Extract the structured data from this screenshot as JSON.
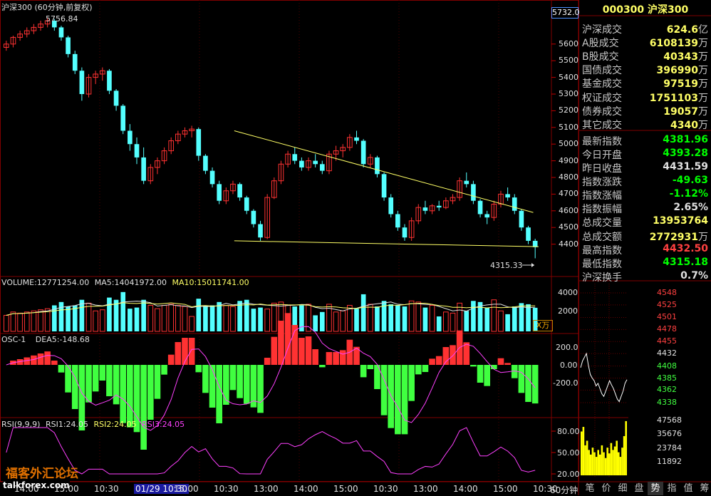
{
  "window": {
    "title": "沪深300 (60分钟,前复权)"
  },
  "main": {
    "title": "沪深300 (60分钟,前复权)",
    "high_label": "5756.84",
    "low_label": "4315.33",
    "top_badge": "5732.0",
    "y_ticks": [
      "5600",
      "5500",
      "5400",
      "5300",
      "5200",
      "5100",
      "5000",
      "4900",
      "4800",
      "4700",
      "4600",
      "4500",
      "4400"
    ]
  },
  "volume": {
    "label_main": "VOLUME:12771254.00",
    "label_ma5": "MA5:14041972.00",
    "label_ma10": "MA10:15011741.00",
    "y_ticks": [
      "4000",
      "2000"
    ],
    "unit": "X万"
  },
  "osc": {
    "label_main": "OSC-1",
    "label_dea": "DEA5:-148.68",
    "y_ticks": [
      "200.0",
      "0.00",
      "-200.0"
    ]
  },
  "rsi": {
    "label_main": "RSI(9,9,9)",
    "label_rsi1": "RSI1:24.05",
    "label_rsi2": "RSI2:24.05",
    "label_rsi3": "RSI3:24.05",
    "y_ticks": [
      "80.00",
      "50.00",
      "20.00"
    ]
  },
  "xaxis": {
    "labels": [
      "14:00",
      "15:00",
      "10:30",
      "01/29 10:30",
      "15:00",
      "10:30",
      "13:00",
      "14:00",
      "15:00",
      "10:30",
      "13:00",
      "14:00",
      "15:00",
      "10:30"
    ],
    "period": "60分钟"
  },
  "watermark": {
    "cn": "福客外汇论坛",
    "en": "talkforex.com"
  },
  "info": {
    "header": "000300 沪深300",
    "rows": [
      {
        "label": "沪深成交",
        "value": "624.6",
        "unit": "亿",
        "color": "#ffff66"
      },
      {
        "label": "A股成交",
        "value": "6108139",
        "unit": "万",
        "color": "#ffff66"
      },
      {
        "label": "B股成交",
        "value": "40343",
        "unit": "万",
        "color": "#ffff66"
      },
      {
        "label": "国债成交",
        "value": "396990",
        "unit": "万",
        "color": "#ffff66"
      },
      {
        "label": "基金成交",
        "value": "97519",
        "unit": "万",
        "color": "#ffff66"
      },
      {
        "label": "权证成交",
        "value": "1751103",
        "unit": "万",
        "color": "#ffff66"
      },
      {
        "label": "债券成交",
        "value": "19057",
        "unit": "万",
        "color": "#ffff66"
      },
      {
        "label": "其它成交",
        "value": "4340",
        "unit": "万",
        "color": "#ffff66"
      },
      {
        "label": "最新指数",
        "value": "4381.96",
        "unit": "",
        "color": "#00ff00"
      },
      {
        "label": "今日开盘",
        "value": "4393.28",
        "unit": "",
        "color": "#00ff00"
      },
      {
        "label": "昨日收盘",
        "value": "4431.59",
        "unit": "",
        "color": "#e0e0e0"
      },
      {
        "label": "指数涨跌",
        "value": "-49.63",
        "unit": "",
        "color": "#00ff00"
      },
      {
        "label": "指数涨幅",
        "value": "-1.12%",
        "unit": "",
        "color": "#00ff00"
      },
      {
        "label": "指数振幅",
        "value": "2.65%",
        "unit": "",
        "color": "#e0e0e0"
      },
      {
        "label": "总成交量",
        "value": "13953764",
        "unit": "",
        "color": "#ffff66"
      },
      {
        "label": "总成交额",
        "value": "2772931",
        "unit": "万",
        "color": "#ffff66"
      },
      {
        "label": "最高指数",
        "value": "4432.50",
        "unit": "",
        "color": "#ff4040"
      },
      {
        "label": "最低指数",
        "value": "4315.18",
        "unit": "",
        "color": "#00ff00"
      },
      {
        "label": "沪深换手",
        "value": "0.7%",
        "unit": "",
        "color": "#e0e0e0"
      }
    ]
  },
  "mini": {
    "price_ticks": [
      "4548",
      "4525",
      "4501",
      "4478",
      "4455",
      "4432",
      "4408",
      "4385",
      "4362",
      "4338"
    ],
    "vol_ticks": [
      "47568",
      "35676",
      "23784",
      "11892"
    ]
  },
  "tabs": [
    "笔",
    "价",
    "细",
    "盘",
    "势",
    "指",
    "值",
    "筹"
  ],
  "colors": {
    "up": "#ff3232",
    "down": "#54ffff",
    "grid": "#800000",
    "trend": "#ffff66"
  },
  "chart_data": {
    "type": "candlestick",
    "title": "沪深300 (60分钟,前复权)",
    "ylim": [
      4300,
      5800
    ],
    "annotations": {
      "high": 5756.84,
      "low": 4315.33
    },
    "trendlines": [
      {
        "from": [
          0.432,
          5080
        ],
        "to": [
          0.99,
          4590
        ]
      },
      {
        "from": [
          0.432,
          4420
        ],
        "to": [
          1.0,
          4385
        ]
      }
    ],
    "series": [
      {
        "name": "OHLC",
        "values": [
          [
            5580,
            5620,
            5560,
            5600
          ],
          [
            5600,
            5650,
            5580,
            5640
          ],
          [
            5640,
            5680,
            5620,
            5660
          ],
          [
            5660,
            5700,
            5640,
            5680
          ],
          [
            5680,
            5720,
            5660,
            5700
          ],
          [
            5700,
            5740,
            5680,
            5720
          ],
          [
            5720,
            5756.84,
            5700,
            5740
          ],
          [
            5740,
            5750,
            5680,
            5700
          ],
          [
            5700,
            5710,
            5620,
            5640
          ],
          [
            5640,
            5650,
            5520,
            5540
          ],
          [
            5540,
            5560,
            5420,
            5440
          ],
          [
            5440,
            5460,
            5260,
            5300
          ],
          [
            5300,
            5420,
            5280,
            5400
          ],
          [
            5400,
            5440,
            5360,
            5420
          ],
          [
            5420,
            5460,
            5380,
            5440
          ],
          [
            5440,
            5450,
            5300,
            5320
          ],
          [
            5320,
            5330,
            5200,
            5230
          ],
          [
            5230,
            5240,
            5060,
            5080
          ],
          [
            5080,
            5120,
            4960,
            5000
          ],
          [
            5000,
            5040,
            4880,
            4920
          ],
          [
            4920,
            4980,
            4760,
            4780
          ],
          [
            4780,
            4880,
            4760,
            4860
          ],
          [
            4860,
            4920,
            4820,
            4900
          ],
          [
            4900,
            4980,
            4880,
            4960
          ],
          [
            4960,
            5040,
            4940,
            5020
          ],
          [
            5020,
            5080,
            5000,
            5060
          ],
          [
            5060,
            5100,
            5040,
            5080
          ],
          [
            5080,
            5110,
            5040,
            5090
          ],
          [
            5090,
            5100,
            4900,
            4930
          ],
          [
            4930,
            4940,
            4820,
            4840
          ],
          [
            4840,
            4860,
            4740,
            4760
          ],
          [
            4760,
            4780,
            4640,
            4660
          ],
          [
            4660,
            4740,
            4640,
            4720
          ],
          [
            4720,
            4780,
            4700,
            4760
          ],
          [
            4760,
            4770,
            4660,
            4680
          ],
          [
            4680,
            4690,
            4580,
            4600
          ],
          [
            4600,
            4610,
            4500,
            4520
          ],
          [
            4520,
            4540,
            4420,
            4440
          ],
          [
            4440,
            4700,
            4430,
            4680
          ],
          [
            4680,
            4800,
            4670,
            4780
          ],
          [
            4780,
            4900,
            4760,
            4880
          ],
          [
            4880,
            4960,
            4860,
            4940
          ],
          [
            4940,
            4980,
            4880,
            4900
          ],
          [
            4900,
            4920,
            4840,
            4860
          ],
          [
            4860,
            4920,
            4840,
            4900
          ],
          [
            4900,
            4940,
            4860,
            4880
          ],
          [
            4880,
            4900,
            4820,
            4840
          ],
          [
            4840,
            4960,
            4820,
            4940
          ],
          [
            4940,
            4990,
            4900,
            4960
          ],
          [
            4960,
            5000,
            4920,
            4980
          ],
          [
            4980,
            5060,
            4960,
            5040
          ],
          [
            5040,
            5080,
            5000,
            5020
          ],
          [
            5020,
            5030,
            4860,
            4880
          ],
          [
            4880,
            4940,
            4860,
            4920
          ],
          [
            4920,
            4930,
            4800,
            4820
          ],
          [
            4820,
            4830,
            4660,
            4680
          ],
          [
            4680,
            4700,
            4560,
            4580
          ],
          [
            4580,
            4600,
            4480,
            4500
          ],
          [
            4500,
            4520,
            4420,
            4440
          ],
          [
            4440,
            4560,
            4420,
            4540
          ],
          [
            4540,
            4640,
            4520,
            4620
          ],
          [
            4620,
            4660,
            4580,
            4600
          ],
          [
            4600,
            4640,
            4580,
            4630
          ],
          [
            4630,
            4660,
            4600,
            4620
          ],
          [
            4620,
            4680,
            4610,
            4660
          ],
          [
            4660,
            4700,
            4640,
            4680
          ],
          [
            4680,
            4800,
            4660,
            4780
          ],
          [
            4780,
            4830,
            4740,
            4760
          ],
          [
            4760,
            4780,
            4640,
            4660
          ],
          [
            4660,
            4670,
            4560,
            4580
          ],
          [
            4580,
            4600,
            4520,
            4560
          ],
          [
            4560,
            4660,
            4540,
            4640
          ],
          [
            4640,
            4720,
            4620,
            4700
          ],
          [
            4700,
            4740,
            4660,
            4680
          ],
          [
            4680,
            4700,
            4580,
            4600
          ],
          [
            4600,
            4610,
            4480,
            4500
          ],
          [
            4500,
            4510,
            4400,
            4420
          ],
          [
            4420,
            4432.5,
            4315.18,
            4381.96
          ]
        ]
      }
    ]
  }
}
